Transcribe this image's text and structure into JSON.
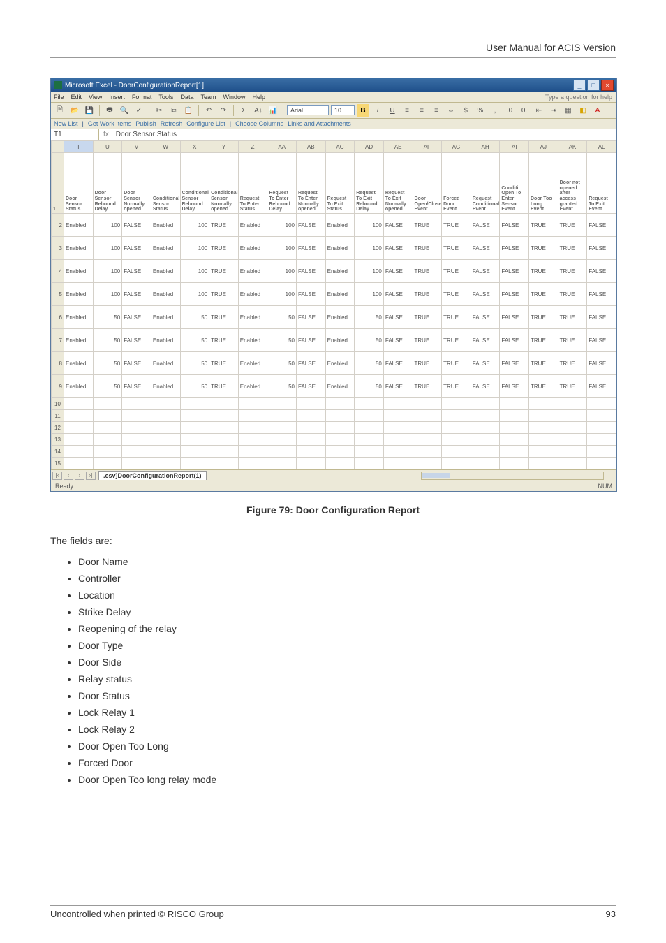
{
  "header_right": "User Manual for ACIS Version",
  "window_title": "Microsoft Excel - DoorConfigurationReport[1]",
  "help_prompt": "Type a question for help",
  "menus": [
    "File",
    "Edit",
    "View",
    "Insert",
    "Format",
    "Tools",
    "Data",
    "Team",
    "Window",
    "Help"
  ],
  "toolbar_font": "Arial",
  "toolbar_size": "10",
  "toolbar2_items": [
    "New List",
    "Get Work Items",
    "Publish",
    "Refresh",
    "Configure List",
    "Choose Columns",
    "Links and Attachments"
  ],
  "namebox": "T1",
  "formula_value": "Door Sensor Status",
  "col_letters": [
    "T",
    "U",
    "V",
    "W",
    "X",
    "Y",
    "Z",
    "AA",
    "AB",
    "AC",
    "AD",
    "AE",
    "AF",
    "AG",
    "AH",
    "AI",
    "AJ",
    "AK",
    "AL"
  ],
  "field_headers": [
    "Door Sensor Status",
    "Door Sensor Rebound Delay",
    "Door Sensor Normally opened",
    "Conditional Sensor Status",
    "Conditional Sensor Rebound Delay",
    "Conditional Sensor Normally opened",
    "Request To Enter Status",
    "Request To Enter Rebound Delay",
    "Request To Enter Normally opened",
    "Request To Exit Status",
    "Request To Exit Rebound Delay",
    "Request To Exit Normally opened",
    "Door Open/Close Event",
    "Forced Door Event",
    "Request Conditional Event",
    "Conditi Open To Enter Sensor Event",
    "Door Too Long Event",
    "Door not opened after access granted Event",
    "Request To Exit Event"
  ],
  "data_rows": [
    {
      "n": "2",
      "r": [
        "Enabled",
        "100",
        "FALSE",
        "Enabled",
        "100",
        "TRUE",
        "Enabled",
        "100",
        "FALSE",
        "Enabled",
        "100",
        "FALSE",
        "TRUE",
        "TRUE",
        "FALSE",
        "FALSE",
        "TRUE",
        "TRUE",
        "FALSE"
      ]
    },
    {
      "n": "3",
      "r": [
        "Enabled",
        "100",
        "FALSE",
        "Enabled",
        "100",
        "TRUE",
        "Enabled",
        "100",
        "FALSE",
        "Enabled",
        "100",
        "FALSE",
        "TRUE",
        "TRUE",
        "FALSE",
        "FALSE",
        "TRUE",
        "TRUE",
        "FALSE"
      ]
    },
    {
      "n": "4",
      "r": [
        "Enabled",
        "100",
        "FALSE",
        "Enabled",
        "100",
        "TRUE",
        "Enabled",
        "100",
        "FALSE",
        "Enabled",
        "100",
        "FALSE",
        "TRUE",
        "TRUE",
        "FALSE",
        "FALSE",
        "TRUE",
        "TRUE",
        "FALSE"
      ]
    },
    {
      "n": "5",
      "r": [
        "Enabled",
        "100",
        "FALSE",
        "Enabled",
        "100",
        "TRUE",
        "Enabled",
        "100",
        "FALSE",
        "Enabled",
        "100",
        "FALSE",
        "TRUE",
        "TRUE",
        "FALSE",
        "FALSE",
        "TRUE",
        "TRUE",
        "FALSE"
      ]
    },
    {
      "n": "6",
      "r": [
        "Enabled",
        "50",
        "FALSE",
        "Enabled",
        "50",
        "TRUE",
        "Enabled",
        "50",
        "FALSE",
        "Enabled",
        "50",
        "FALSE",
        "TRUE",
        "TRUE",
        "FALSE",
        "FALSE",
        "TRUE",
        "TRUE",
        "FALSE"
      ]
    },
    {
      "n": "7",
      "r": [
        "Enabled",
        "50",
        "FALSE",
        "Enabled",
        "50",
        "TRUE",
        "Enabled",
        "50",
        "FALSE",
        "Enabled",
        "50",
        "FALSE",
        "TRUE",
        "TRUE",
        "FALSE",
        "FALSE",
        "TRUE",
        "TRUE",
        "FALSE"
      ]
    },
    {
      "n": "8",
      "r": [
        "Enabled",
        "50",
        "FALSE",
        "Enabled",
        "50",
        "TRUE",
        "Enabled",
        "50",
        "FALSE",
        "Enabled",
        "50",
        "FALSE",
        "TRUE",
        "TRUE",
        "FALSE",
        "FALSE",
        "TRUE",
        "TRUE",
        "FALSE"
      ]
    },
    {
      "n": "9",
      "r": [
        "Enabled",
        "50",
        "FALSE",
        "Enabled",
        "50",
        "TRUE",
        "Enabled",
        "50",
        "FALSE",
        "Enabled",
        "50",
        "FALSE",
        "TRUE",
        "TRUE",
        "FALSE",
        "FALSE",
        "TRUE",
        "TRUE",
        "FALSE"
      ]
    }
  ],
  "blank_rows": [
    "10",
    "11",
    "12",
    "13",
    "14",
    "15"
  ],
  "sheet_tab": ".csv]DoorConfigurationReport(1)",
  "status_left": "Ready",
  "status_right": "NUM",
  "figure_caption": "Figure 79: Door Configuration Report",
  "fields_intro": "The fields are:",
  "fields_list": [
    "Door Name",
    "Controller",
    "Location",
    "Strike Delay",
    "Reopening of the relay",
    "Door Type",
    "Door Side",
    "Relay status",
    "Door Status",
    "Lock Relay 1",
    "Lock Relay 2",
    "Door Open Too Long",
    "Forced Door",
    "Door Open Too long relay mode"
  ],
  "footer_left": "Uncontrolled when printed © RISCO Group",
  "footer_right": "93"
}
